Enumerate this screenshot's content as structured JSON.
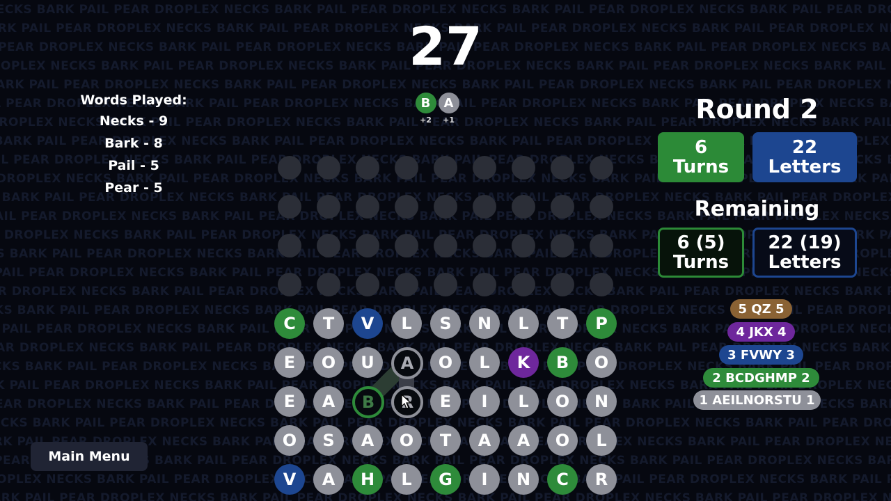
{
  "background_phrase": "NECKS BARK PAIL PEAR DROPLEX",
  "score": "27",
  "words_played": {
    "heading": "Words Played:",
    "items": [
      "Necks - 9",
      "Bark - 8",
      "Pail - 5",
      "Pear - 5"
    ]
  },
  "pending": [
    {
      "letter": "B",
      "points": "+2",
      "color": "#2e8b3a"
    },
    {
      "letter": "A",
      "points": "+1",
      "color": "#8e9099"
    }
  ],
  "round": {
    "title": "Round 2",
    "turns": "6",
    "turns_label": "Turns",
    "letters": "22",
    "letters_label": "Letters"
  },
  "remaining": {
    "title": "Remaining",
    "turns": "6 (5)",
    "turns_label": "Turns",
    "letters": "22 (19)",
    "letters_label": "Letters"
  },
  "letter_values": [
    {
      "label": "5 QZ 5",
      "color": "#8a6234"
    },
    {
      "label": "4 JKX 4",
      "color": "#6e279c"
    },
    {
      "label": "3 FVWY 3",
      "color": "#1d4690"
    },
    {
      "label": "2 BCDGHMP 2",
      "color": "#2e8b3a"
    },
    {
      "label": "1 AEILNORSTU 1",
      "color": "#8e9099"
    }
  ],
  "tile_colors": {
    "1": "#8e9099",
    "2": "#2e8b3a",
    "3": "#1d4690",
    "4": "#6e279c",
    "5": "#8a6234"
  },
  "grid_rows": [
    [
      {
        "l": "C",
        "v": 2
      },
      {
        "l": "T",
        "v": 1
      },
      {
        "l": "V",
        "v": 3
      },
      {
        "l": "L",
        "v": 1
      },
      {
        "l": "S",
        "v": 1
      },
      {
        "l": "N",
        "v": 1
      },
      {
        "l": "L",
        "v": 1
      },
      {
        "l": "T",
        "v": 1
      },
      {
        "l": "P",
        "v": 2
      }
    ],
    [
      {
        "l": "E",
        "v": 1
      },
      {
        "l": "O",
        "v": 1
      },
      {
        "l": "U",
        "v": 1
      },
      {
        "l": "A",
        "v": 1,
        "sel": true
      },
      {
        "l": "O",
        "v": 1
      },
      {
        "l": "L",
        "v": 1
      },
      {
        "l": "K",
        "v": 4
      },
      {
        "l": "B",
        "v": 2
      },
      {
        "l": "O",
        "v": 1
      }
    ],
    [
      {
        "l": "E",
        "v": 1
      },
      {
        "l": "A",
        "v": 1
      },
      {
        "l": "B",
        "v": 2,
        "sel": true
      },
      {
        "l": "R",
        "v": 1,
        "sel": true
      },
      {
        "l": "E",
        "v": 1
      },
      {
        "l": "I",
        "v": 1
      },
      {
        "l": "L",
        "v": 1
      },
      {
        "l": "O",
        "v": 1
      },
      {
        "l": "N",
        "v": 1
      }
    ],
    [
      {
        "l": "O",
        "v": 1
      },
      {
        "l": "S",
        "v": 1
      },
      {
        "l": "A",
        "v": 1
      },
      {
        "l": "O",
        "v": 1
      },
      {
        "l": "T",
        "v": 1
      },
      {
        "l": "A",
        "v": 1
      },
      {
        "l": "A",
        "v": 1
      },
      {
        "l": "O",
        "v": 1
      },
      {
        "l": "L",
        "v": 1
      }
    ],
    [
      {
        "l": "V",
        "v": 3
      },
      {
        "l": "A",
        "v": 1
      },
      {
        "l": "H",
        "v": 2
      },
      {
        "l": "L",
        "v": 1
      },
      {
        "l": "G",
        "v": 2
      },
      {
        "l": "I",
        "v": 1
      },
      {
        "l": "N",
        "v": 1
      },
      {
        "l": "C",
        "v": 2
      },
      {
        "l": "R",
        "v": 1
      }
    ]
  ],
  "empty_rows": 4,
  "main_menu_label": "Main Menu"
}
